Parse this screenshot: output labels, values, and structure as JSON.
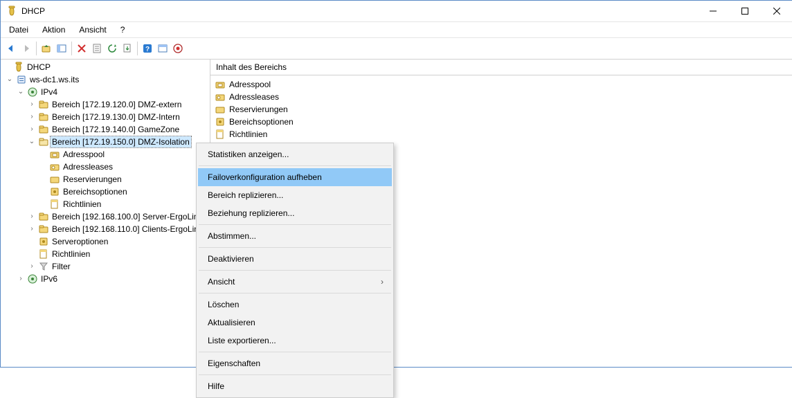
{
  "window": {
    "title": "DHCP"
  },
  "menu": {
    "datei": "Datei",
    "aktion": "Aktion",
    "ansicht": "Ansicht",
    "help": "?"
  },
  "tree": {
    "root": "DHCP",
    "server": "ws-dc1.ws.its",
    "ipv4": "IPv4",
    "scope1": "Bereich [172.19.120.0] DMZ-extern",
    "scope2": "Bereich [172.19.130.0] DMZ-Intern",
    "scope3": "Bereich [172.19.140.0] GameZone",
    "scope4": "Bereich [172.19.150.0] DMZ-Isolation",
    "scope4_pool": "Adresspool",
    "scope4_leases": "Adressleases",
    "scope4_res": "Reservierungen",
    "scope4_opts": "Bereichsoptionen",
    "scope4_pol": "Richtlinien",
    "scope5": "Bereich [192.168.100.0] Server-ErgoLine",
    "scope6": "Bereich [192.168.110.0] Clients-ErgoLine",
    "srvopt": "Serveroptionen",
    "pol": "Richtlinien",
    "filter": "Filter",
    "ipv6": "IPv6"
  },
  "list": {
    "header": "Inhalt des Bereichs",
    "items": {
      "pool": "Adresspool",
      "leases": "Adressleases",
      "res": "Reservierungen",
      "opts": "Bereichsoptionen",
      "pol": "Richtlinien"
    }
  },
  "ctx": {
    "stats": "Statistiken anzeigen...",
    "failover": "Failoverkonfiguration aufheben",
    "replicate_scope": "Bereich replizieren...",
    "replicate_rel": "Beziehung replizieren...",
    "reconcile": "Abstimmen...",
    "deactivate": "Deaktivieren",
    "view": "Ansicht",
    "delete": "Löschen",
    "refresh": "Aktualisieren",
    "export": "Liste exportieren...",
    "props": "Eigenschaften",
    "help": "Hilfe"
  }
}
